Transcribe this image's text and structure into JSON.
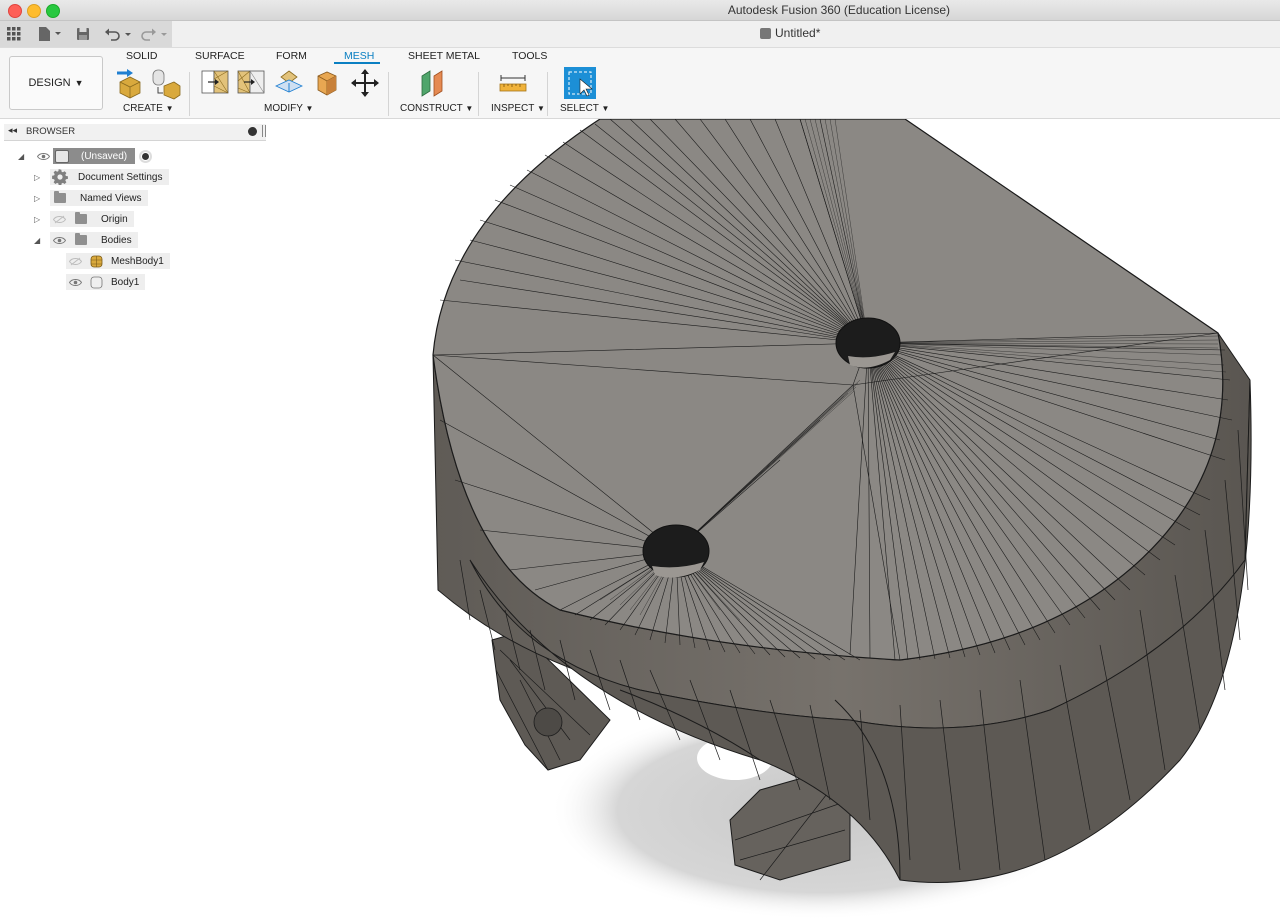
{
  "window": {
    "title": "Autodesk Fusion 360 (Education License)"
  },
  "document": {
    "tab_name": "Untitled*"
  },
  "workspace": {
    "label": "DESIGN"
  },
  "toolbar": {
    "tabs": [
      {
        "label": "SOLID"
      },
      {
        "label": "SURFACE"
      },
      {
        "label": "FORM"
      },
      {
        "label": "MESH",
        "active": true
      },
      {
        "label": "SHEET METAL"
      },
      {
        "label": "TOOLS"
      }
    ],
    "groups": {
      "create": "CREATE",
      "modify": "MODIFY",
      "construct": "CONSTRUCT",
      "inspect": "INSPECT",
      "select": "SELECT"
    }
  },
  "browser": {
    "title": "BROWSER",
    "root": "(Unsaved)",
    "items": [
      {
        "label": "Document Settings",
        "icon": "gear-icon"
      },
      {
        "label": "Named Views",
        "icon": "folder-icon"
      },
      {
        "label": "Origin",
        "icon": "folder-icon"
      },
      {
        "label": "Bodies",
        "icon": "folder-icon"
      }
    ],
    "bodies": [
      {
        "label": "MeshBody1",
        "icon": "mesh-body-icon"
      },
      {
        "label": "Body1",
        "icon": "solid-body-icon"
      }
    ]
  },
  "colors": {
    "accent": "#0a7fc2",
    "mesh_body": "#8b8884",
    "mesh_edges": "#1b1b1b"
  }
}
